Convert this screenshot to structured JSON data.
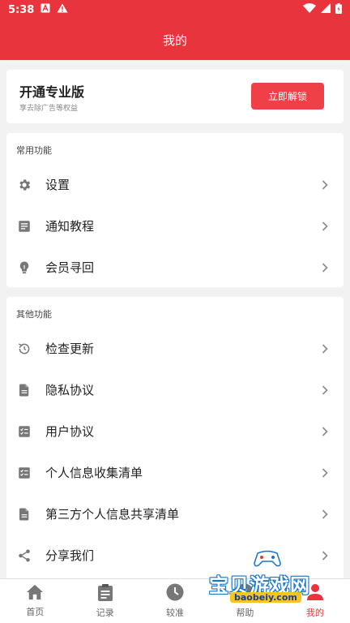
{
  "status_bar": {
    "time": "5:38"
  },
  "header": {
    "title": "我的"
  },
  "pro_card": {
    "title": "开通专业版",
    "subtitle": "享去除广告等权益",
    "button_label": "立即解锁"
  },
  "common_section": {
    "title": "常用功能",
    "items": [
      {
        "label": "设置",
        "icon": "gear-icon"
      },
      {
        "label": "通知教程",
        "icon": "document-icon"
      },
      {
        "label": "会员寻回",
        "icon": "lightbulb-icon"
      }
    ]
  },
  "other_section": {
    "title": "其他功能",
    "items": [
      {
        "label": "检查更新",
        "icon": "update-icon"
      },
      {
        "label": "隐私协议",
        "icon": "file-icon"
      },
      {
        "label": "用户协议",
        "icon": "checklist-icon"
      },
      {
        "label": "个人信息收集清单",
        "icon": "checklist-icon"
      },
      {
        "label": "第三方个人信息共享清单",
        "icon": "file-icon"
      },
      {
        "label": "分享我们",
        "icon": "share-icon"
      }
    ]
  },
  "bottom_nav": {
    "items": [
      {
        "label": "首页",
        "icon": "home-icon"
      },
      {
        "label": "记录",
        "icon": "clipboard-icon"
      },
      {
        "label": "较准",
        "icon": "clock-icon"
      },
      {
        "label": "帮助",
        "icon": "help-icon"
      },
      {
        "label": "我的",
        "icon": "user-icon",
        "active": true
      }
    ]
  },
  "watermark": {
    "text": "宝贝游戏网",
    "url": "baobeiy.com"
  },
  "colors": {
    "accent": "#e8353d",
    "button": "#ef4048",
    "background": "#f2f2f2"
  }
}
